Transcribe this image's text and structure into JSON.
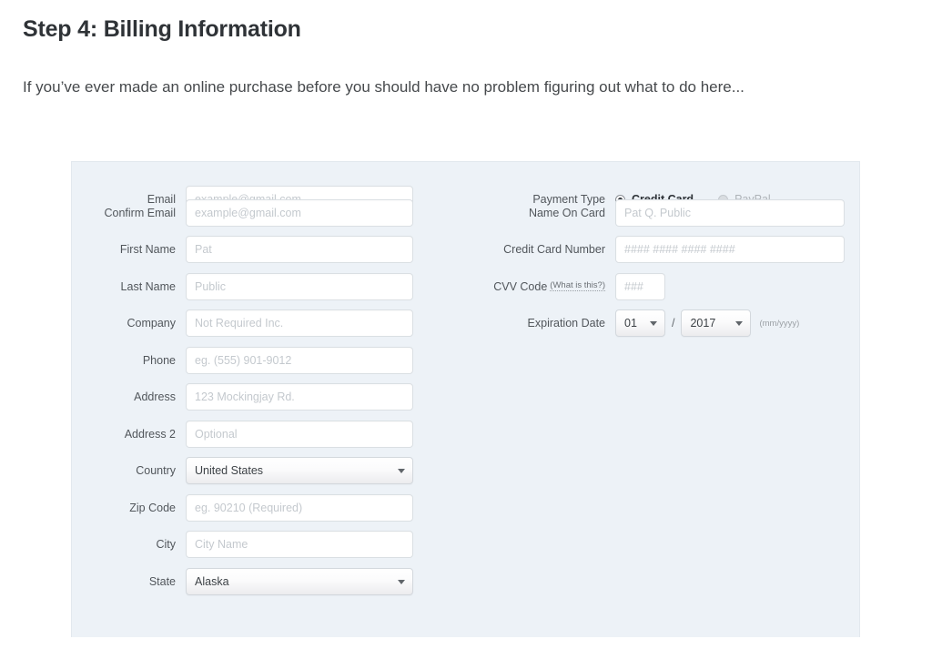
{
  "heading": "Step 4: Billing Information",
  "intro": "If you’ve ever made an online purchase before you should have no problem figuring out what to do here...",
  "form": {
    "left_fields": [
      {
        "label": "Email",
        "type": "input",
        "placeholder": "example@gmail.com"
      },
      {
        "label": "Confirm Email",
        "type": "input",
        "placeholder": "example@gmail.com"
      },
      {
        "label": "First Name",
        "type": "input",
        "placeholder": "Pat"
      },
      {
        "label": "Last Name",
        "type": "input",
        "placeholder": "Public"
      },
      {
        "label": "Company",
        "type": "input",
        "placeholder": "Not Required Inc."
      },
      {
        "label": "Phone",
        "type": "input",
        "placeholder": "eg. (555) 901-9012"
      },
      {
        "label": "Address",
        "type": "input",
        "placeholder": "123 Mockingjay Rd."
      },
      {
        "label": "Address 2",
        "type": "input",
        "placeholder": "Optional"
      },
      {
        "label": "Country",
        "type": "select",
        "value": "United States"
      },
      {
        "label": "Zip Code",
        "type": "input",
        "placeholder": "eg. 90210 (Required)"
      },
      {
        "label": "City",
        "type": "input",
        "placeholder": "City Name"
      },
      {
        "label": "State",
        "type": "select",
        "value": "Alaska"
      }
    ],
    "payment_type": {
      "label": "Payment Type",
      "options": [
        {
          "label": "Credit Card",
          "selected": true
        },
        {
          "label": "PayPal",
          "selected": false
        }
      ]
    },
    "name_on_card": {
      "label": "Name On Card",
      "placeholder": "Pat Q. Public"
    },
    "credit_card_number": {
      "label": "Credit Card Number",
      "placeholder": "#### #### #### ####"
    },
    "cvv": {
      "label": "CVV Code",
      "help": "(What is this?)",
      "placeholder": "###"
    },
    "expiration": {
      "label": "Expiration Date",
      "month": "01",
      "separator": "/",
      "year": "2017",
      "hint": "(mm/yyyy)"
    }
  },
  "icons": {
    "caret": "chevron-down-icon"
  },
  "colors": {
    "panel_bg": "#edf2f7",
    "panel_border": "#e2e8ee",
    "heading_text": "#2f3337",
    "label_text": "#51565b",
    "placeholder_text": "#c4c9ce",
    "page_bg": "#ffffff"
  }
}
